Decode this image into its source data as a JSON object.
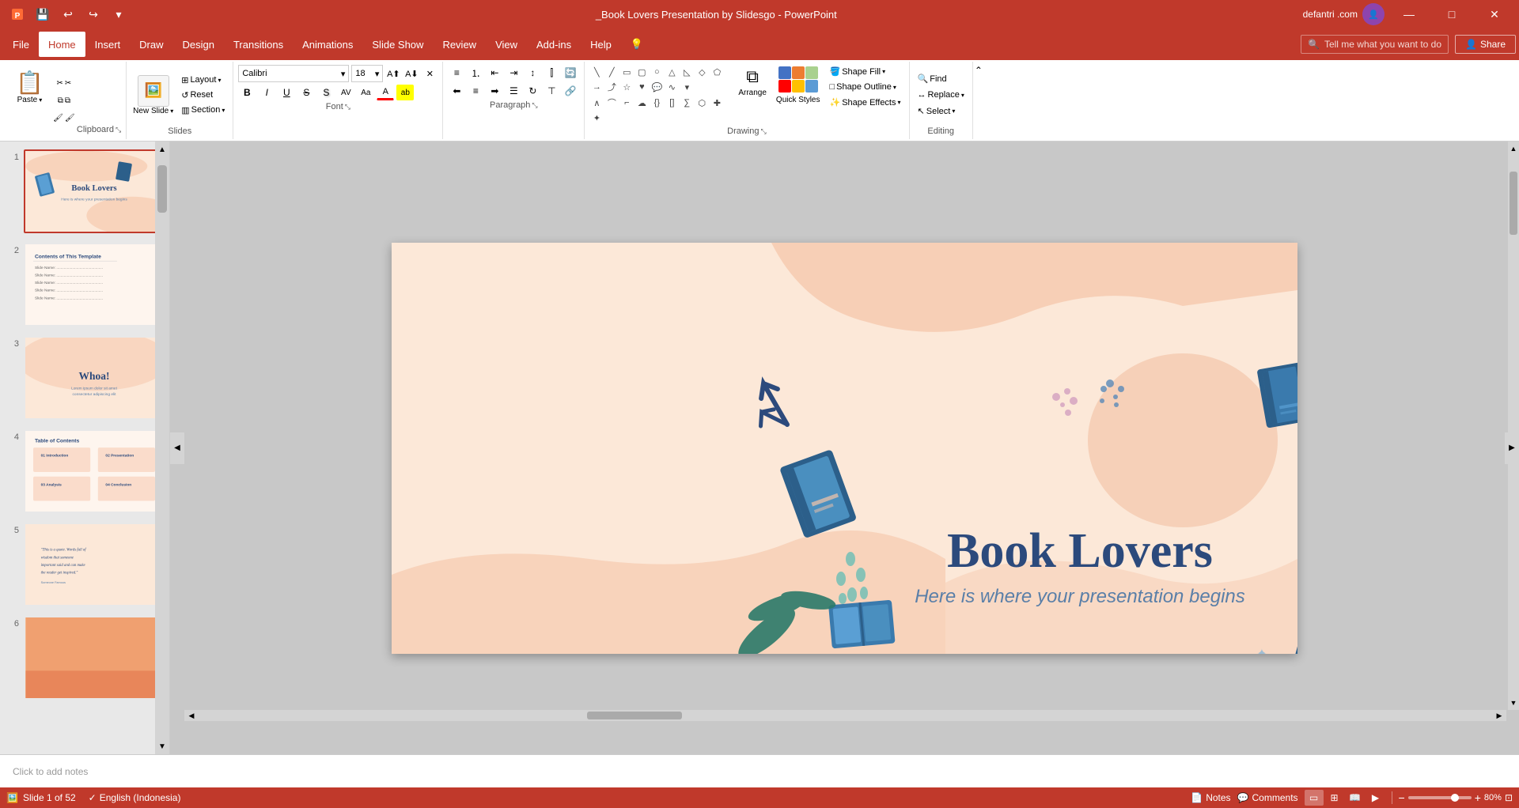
{
  "window": {
    "title": "_Book Lovers Presentation by Slidesgo - PowerPoint",
    "minimize": "—",
    "maximize": "□",
    "close": "✕"
  },
  "quickAccess": {
    "save": "💾",
    "undo": "↩",
    "redo": "↪",
    "customize": "▾"
  },
  "user": {
    "name": "defantri .com",
    "avatar": "👤",
    "shareLabel": "Share"
  },
  "menuBar": {
    "items": [
      "File",
      "Home",
      "Insert",
      "Draw",
      "Design",
      "Transitions",
      "Animations",
      "Slide Show",
      "Review",
      "View",
      "Add-ins",
      "Help"
    ],
    "active": "Home",
    "searchPlaceholder": "Tell me what you want to do",
    "searchIcon": "🔍"
  },
  "ribbon": {
    "groups": {
      "clipboard": {
        "label": "Clipboard",
        "paste": "Paste",
        "cut": "✂",
        "copy": "⧉",
        "formatPainter": "🖌"
      },
      "slides": {
        "label": "Slides",
        "newSlide": "New Slide",
        "layout": "Layout",
        "reset": "Reset",
        "section": "Section"
      },
      "font": {
        "label": "Font",
        "fontName": "Calibri",
        "fontSize": "18",
        "bold": "B",
        "italic": "I",
        "underline": "U",
        "strikethrough": "S",
        "sizeUp": "A↑",
        "sizeDown": "A↓",
        "clear": "✕",
        "fontColor": "A",
        "textHighlight": "ab"
      },
      "paragraph": {
        "label": "Paragraph",
        "bullets": "☰",
        "numbering": "1☰",
        "indent": "→",
        "outdent": "←",
        "lineSpacing": "↕",
        "cols": "⫿",
        "alignLeft": "≡",
        "alignCenter": "≡",
        "alignRight": "≡",
        "justify": "≡",
        "textDir": "⇌"
      },
      "drawing": {
        "label": "Drawing",
        "shapes": [
          "▭",
          "○",
          "△",
          "◇",
          "⬠",
          "→",
          "⤴",
          "☆",
          "♥",
          "—",
          "╲",
          "╱",
          "⌒",
          "∿"
        ],
        "arrange": "Arrange",
        "quickStyles": "Quick Styles",
        "shapeFill": "Shape Fill",
        "shapeOutline": "Shape Outline",
        "shapeEffects": "Shape Effects"
      },
      "editing": {
        "label": "Editing",
        "find": "Find",
        "replace": "Replace",
        "select": "Select"
      }
    }
  },
  "slidePanel": {
    "slides": [
      {
        "number": 1,
        "active": true,
        "label": "Book Lovers title slide"
      },
      {
        "number": 2,
        "active": false,
        "label": "Contents slide"
      },
      {
        "number": 3,
        "active": false,
        "label": "Whoa slide"
      },
      {
        "number": 4,
        "active": false,
        "label": "Table of contents slide"
      },
      {
        "number": 5,
        "active": false,
        "label": "Quote slide"
      },
      {
        "number": 6,
        "active": false,
        "label": "Orange slide"
      }
    ]
  },
  "slide": {
    "title": "Book Lovers",
    "subtitle": "Here is where your presentation begins",
    "background": "#fce8d8"
  },
  "notes": {
    "placeholder": "Click to add notes",
    "label": "Notes",
    "comments": "Comments"
  },
  "statusBar": {
    "slideInfo": "Slide 1 of 52",
    "language": "English (Indonesia)",
    "notesLabel": "Notes",
    "commentsLabel": "Comments",
    "zoom": "80%",
    "fitIcon": "⊡"
  }
}
